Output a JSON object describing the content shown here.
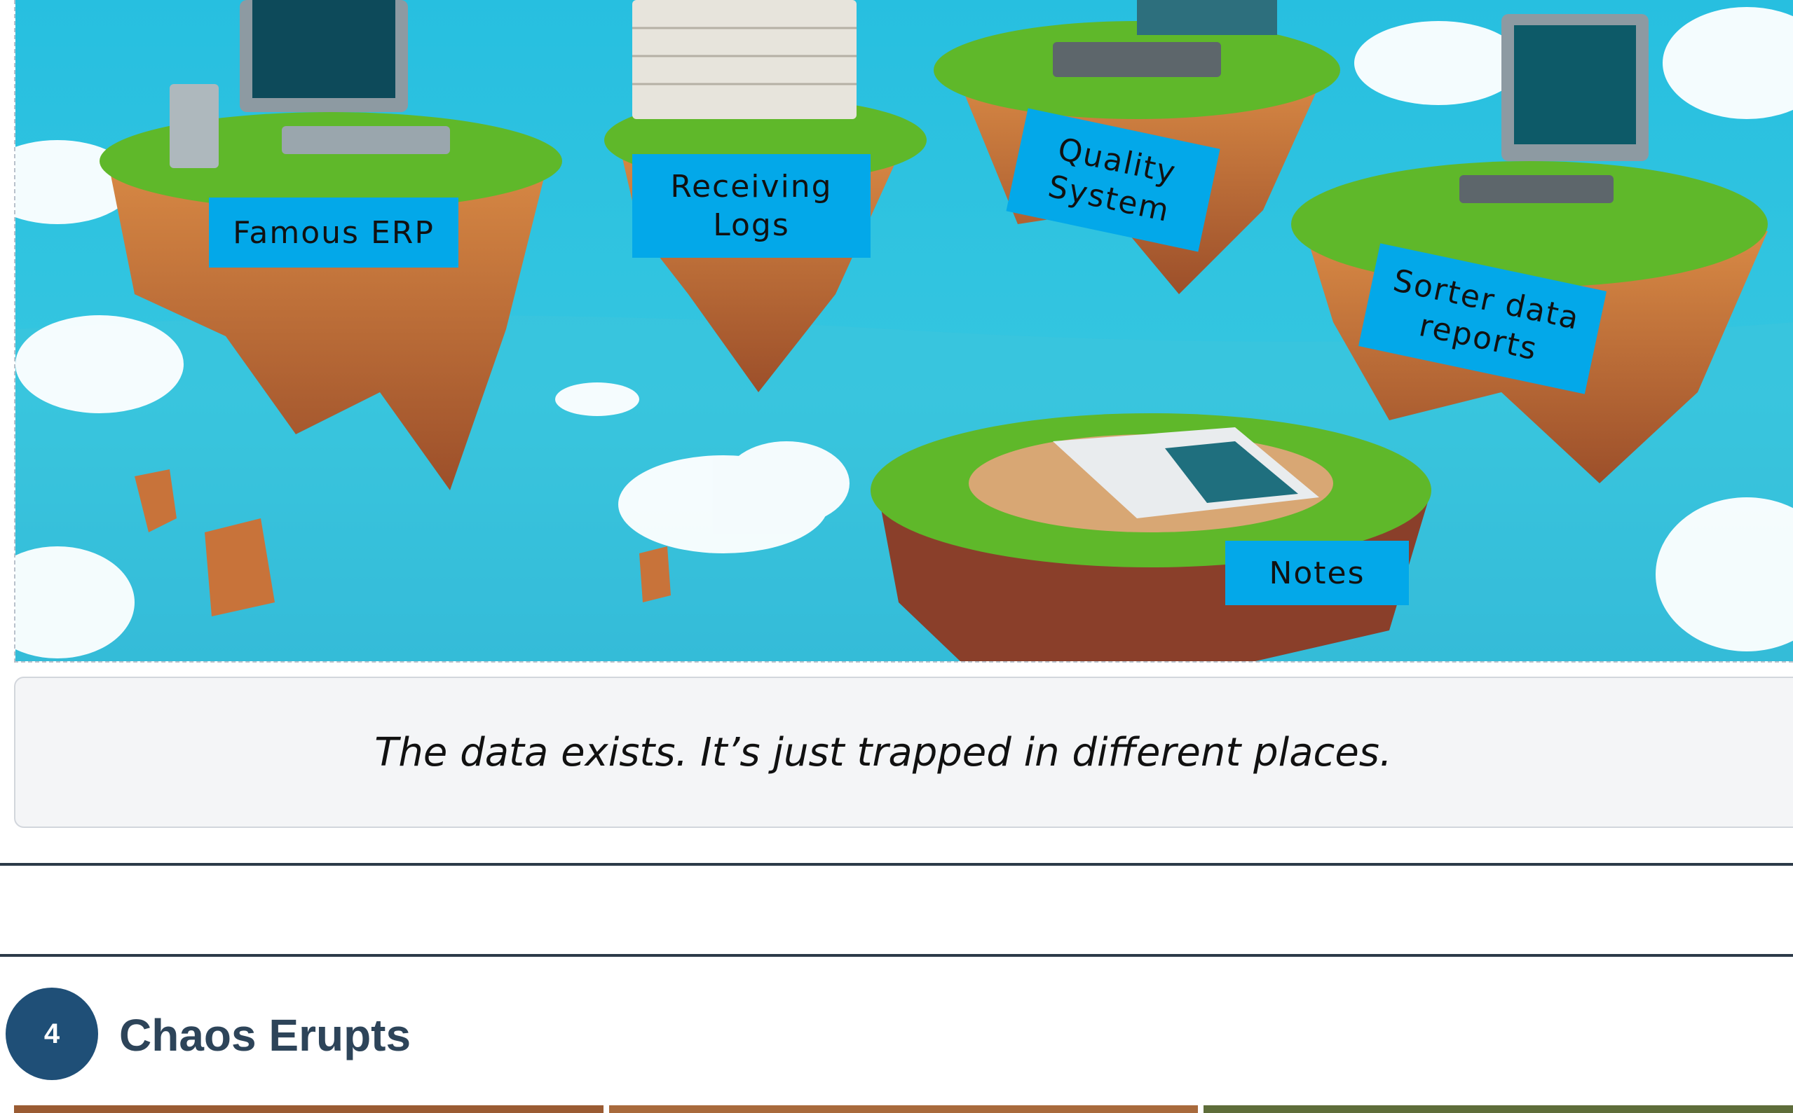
{
  "illustration": {
    "labels": {
      "famous_erp": "Famous ERP",
      "receiving_logs": "Receiving Logs",
      "quality_system": "Quality System",
      "sorter_reports": "Sorter data reports",
      "notes": "Notes"
    },
    "colors": {
      "sky": "#2ec3dd",
      "label_bg": "#03a8e9",
      "grass": "#5fb82a",
      "rock": "#c8733a"
    }
  },
  "caption": {
    "text": "The data exists. It’s just trapped in different places."
  },
  "section": {
    "number": "4",
    "title": "Chaos Erupts"
  }
}
